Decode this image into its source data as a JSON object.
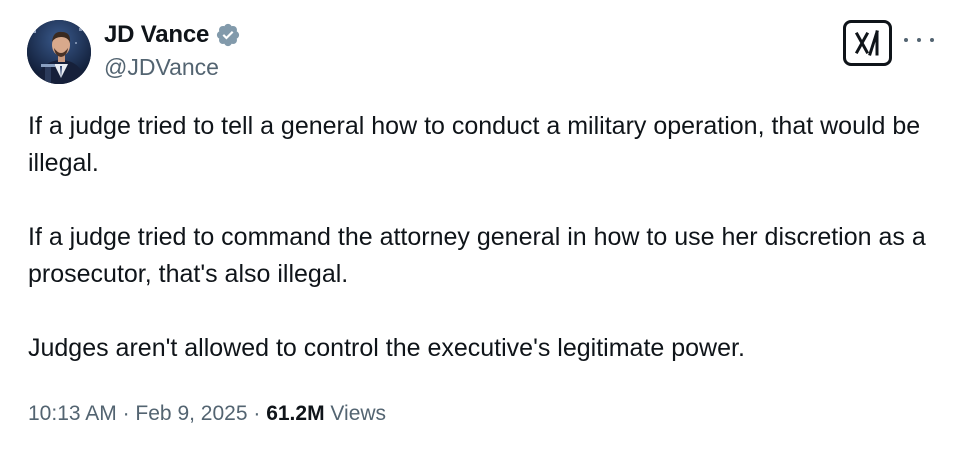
{
  "author": {
    "display_name": "JD Vance",
    "handle": "@JDVance",
    "verified": true,
    "verified_icon": "verified-badge-icon",
    "avatar_icon": "profile-photo"
  },
  "header_actions": {
    "grok_icon": "grok-logo-icon",
    "more_icon": "more-options-icon"
  },
  "tweet": {
    "paragraphs": [
      "If a judge tried to tell a general how to conduct a military operation, that would be illegal.",
      "If a judge tried to command the attorney general in how to use her discretion as a prosecutor, that's also illegal.",
      "Judges aren't allowed to control the executive's legitimate power."
    ]
  },
  "meta": {
    "time": "10:13 AM",
    "separator": "·",
    "date": "Feb 9, 2025",
    "views_count": "61.2M",
    "views_label": "Views"
  },
  "colors": {
    "text_primary": "#0f1419",
    "text_secondary": "#536471",
    "verified": "#829aab"
  }
}
